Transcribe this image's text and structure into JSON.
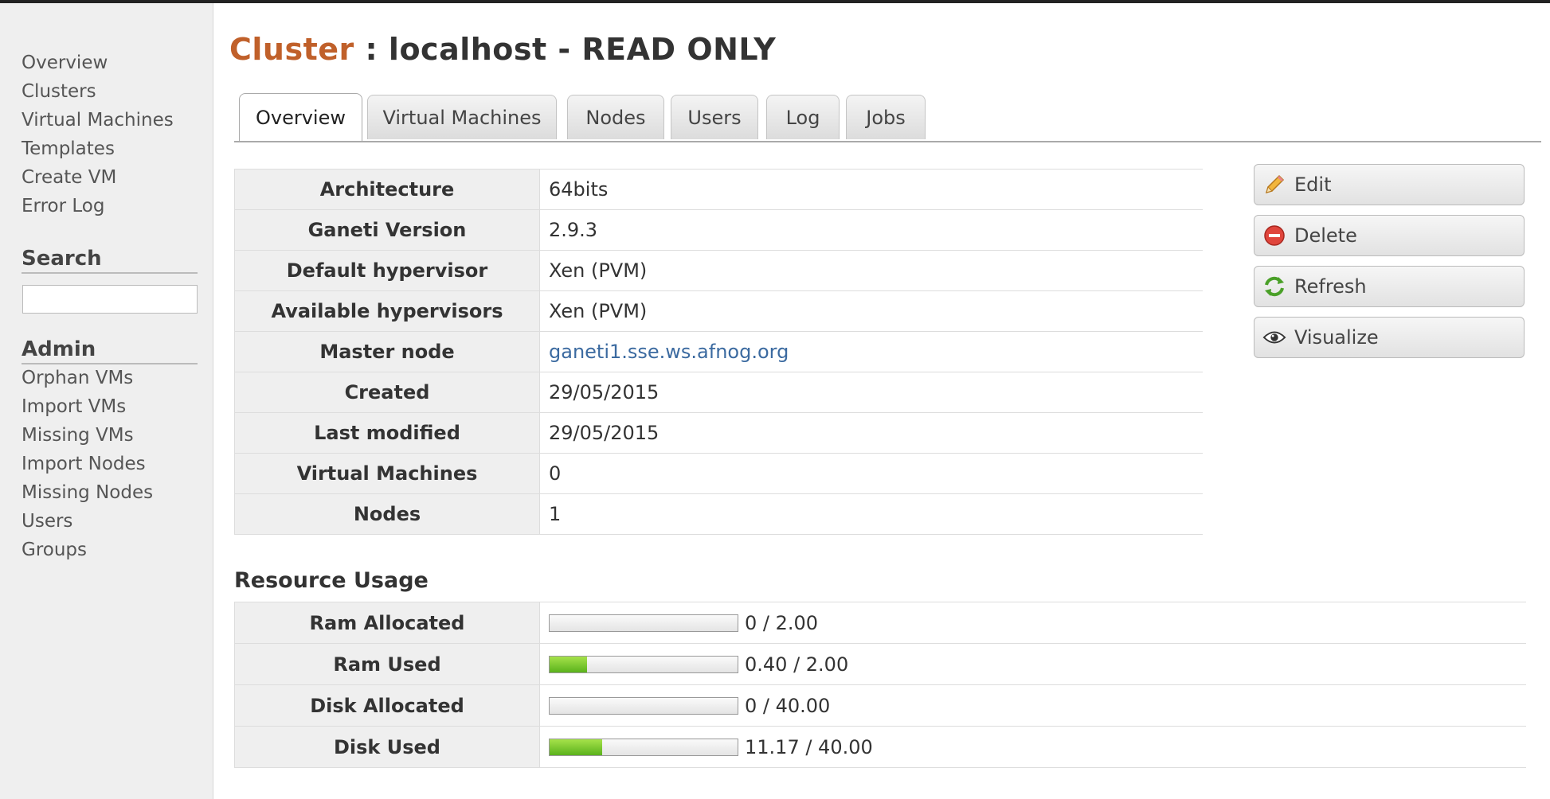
{
  "sidebar": {
    "nav": [
      "Overview",
      "Clusters",
      "Virtual Machines",
      "Templates",
      "Create VM",
      "Error Log"
    ],
    "search_heading": "Search",
    "admin_heading": "Admin",
    "admin_items": [
      "Orphan VMs",
      "Import VMs",
      "Missing VMs",
      "Import Nodes",
      "Missing Nodes",
      "Users",
      "Groups"
    ]
  },
  "header": {
    "title_accent": "Cluster",
    "title_rest": " : localhost - READ ONLY"
  },
  "tabs": [
    "Overview",
    "Virtual Machines",
    "Nodes",
    "Users",
    "Log",
    "Jobs"
  ],
  "info": [
    {
      "label": "Architecture",
      "value": "64bits"
    },
    {
      "label": "Ganeti Version",
      "value": "2.9.3"
    },
    {
      "label": "Default hypervisor",
      "value": "Xen (PVM)"
    },
    {
      "label": "Available hypervisors",
      "value": "Xen (PVM)"
    },
    {
      "label": "Master node",
      "value": "ganeti1.sse.ws.afnog.org"
    },
    {
      "label": "Created",
      "value": "29/05/2015"
    },
    {
      "label": "Last modified",
      "value": "29/05/2015"
    },
    {
      "label": "Virtual Machines",
      "value": "0"
    },
    {
      "label": "Nodes",
      "value": "1"
    }
  ],
  "actions": [
    {
      "label": "Edit",
      "icon": "pencil-icon"
    },
    {
      "label": "Delete",
      "icon": "delete-icon"
    },
    {
      "label": "Refresh",
      "icon": "refresh-icon"
    },
    {
      "label": "Visualize",
      "icon": "eye-icon"
    }
  ],
  "resource_title": "Resource Usage",
  "resources": [
    {
      "label": "Ram Allocated",
      "text": "0 / 2.00",
      "fraction": 0.0
    },
    {
      "label": "Ram Used",
      "text": "0.40 / 2.00",
      "fraction": 0.2
    },
    {
      "label": "Disk Allocated",
      "text": "0 / 40.00",
      "fraction": 0.0
    },
    {
      "label": "Disk Used",
      "text": "11.17 / 40.00",
      "fraction": 0.28
    }
  ],
  "colors": {
    "accent": "#c0602a",
    "link": "#3b6aa0",
    "bar_fill": "#6bbf24"
  }
}
